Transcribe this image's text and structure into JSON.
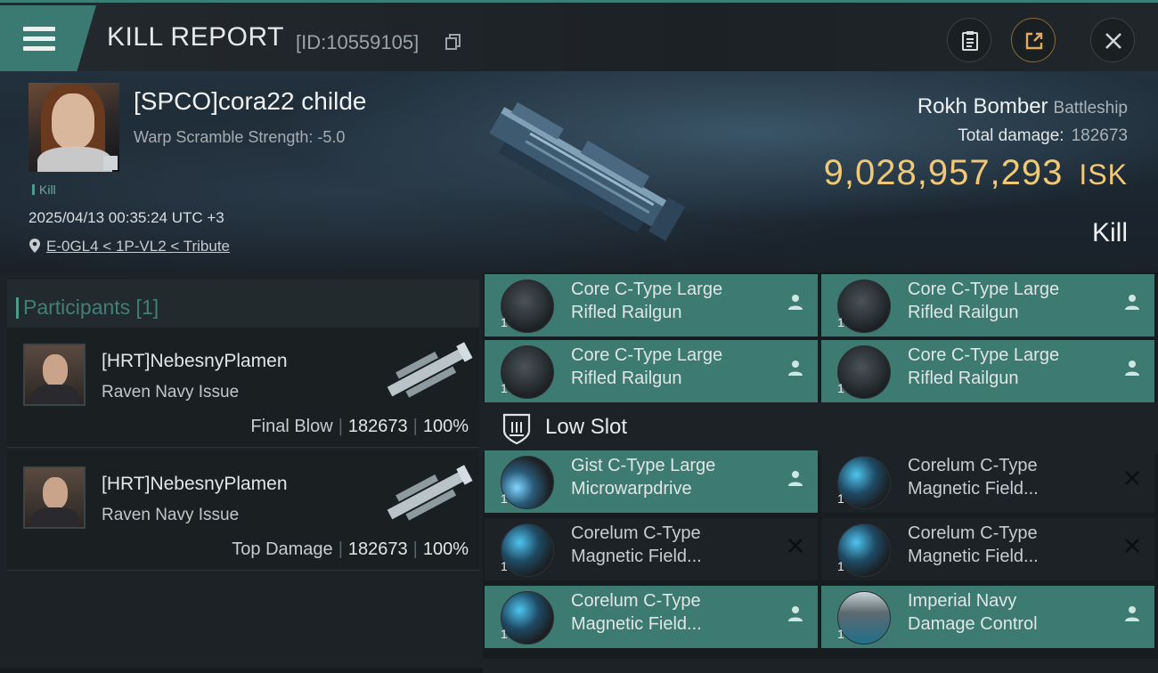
{
  "header": {
    "title": "KILL REPORT",
    "report_id": "[ID:10559105]",
    "buttons": {
      "clipboard_icon": "clipboard-icon",
      "share_icon": "share-icon",
      "close_icon": "close-icon"
    }
  },
  "victim": {
    "name": "[SPCO]cora22 childe",
    "warp_scramble": "Warp Scramble Strength: -5.0",
    "tag": "Kill",
    "datetime": "2025/04/13 00:35:24 UTC +3",
    "location": "E-0GL4 < 1P-VL2 < Tribute",
    "ship_name": "Rokh Bomber",
    "ship_class": "Battleship",
    "total_damage_label": "Total damage:",
    "total_damage": "182673",
    "isk_value": "9,028,957,293",
    "isk_unit": "ISK",
    "result": "Kill"
  },
  "participants": {
    "header": "Participants [1]",
    "cards": [
      {
        "name": "[HRT]NebesnyPlamen",
        "ship": "Raven Navy Issue",
        "role": "Final Blow",
        "damage": "182673",
        "percent": "100%"
      },
      {
        "name": "[HRT]NebesnyPlamen",
        "ship": "Raven Navy Issue",
        "role": "Top Damage",
        "damage": "182673",
        "percent": "100%"
      }
    ]
  },
  "fitting": {
    "low_slot_label": "Low Slot",
    "high_slots": [
      {
        "name_line1": "Core C-Type Large",
        "name_line2": "Rifled Railgun",
        "qty": "1",
        "state": "dropped"
      },
      {
        "name_line1": "Core C-Type Large",
        "name_line2": "Rifled Railgun",
        "qty": "1",
        "state": "dropped"
      },
      {
        "name_line1": "Core C-Type Large",
        "name_line2": "Rifled Railgun",
        "qty": "1",
        "state": "dropped"
      },
      {
        "name_line1": "Core C-Type Large",
        "name_line2": "Rifled Railgun",
        "qty": "1",
        "state": "dropped"
      }
    ],
    "low_slots": [
      {
        "name_line1": "Gist C-Type Large",
        "name_line2": "Microwarpdrive",
        "qty": "1",
        "state": "dropped"
      },
      {
        "name_line1": "Corelum C-Type",
        "name_line2": "Magnetic Field...",
        "qty": "1",
        "state": "destroyed"
      },
      {
        "name_line1": "Corelum C-Type",
        "name_line2": "Magnetic Field...",
        "qty": "1",
        "state": "destroyed"
      },
      {
        "name_line1": "Corelum C-Type",
        "name_line2": "Magnetic Field...",
        "qty": "1",
        "state": "destroyed"
      },
      {
        "name_line1": "Corelum C-Type",
        "name_line2": "Magnetic Field...",
        "qty": "1",
        "state": "dropped"
      },
      {
        "name_line1": "Imperial Navy",
        "name_line2": "Damage Control",
        "qty": "1",
        "state": "dropped"
      }
    ]
  },
  "colors": {
    "accent_teal": "#3d7a71",
    "isk_gold": "#f0c878",
    "panel_dark": "#1c2225"
  }
}
